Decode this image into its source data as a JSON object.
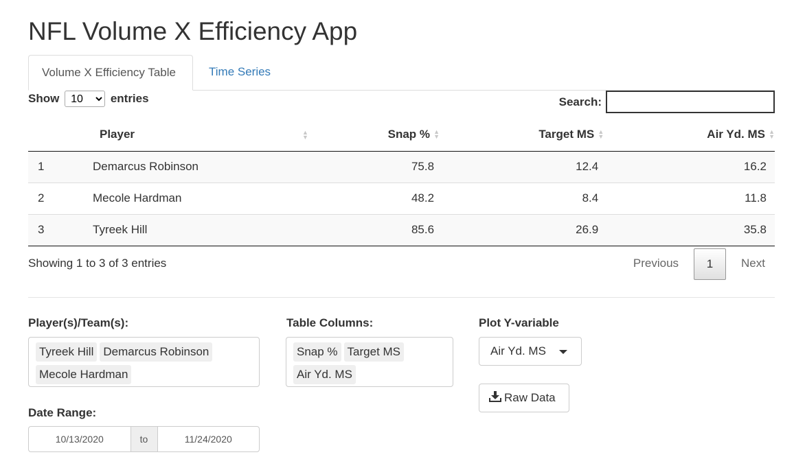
{
  "app": {
    "title": "NFL Volume X Efficiency App"
  },
  "tabs": [
    {
      "label": "Volume X Efficiency Table",
      "active": true
    },
    {
      "label": "Time Series",
      "active": false
    }
  ],
  "table_controls": {
    "show_label": "Show",
    "entries_value": "10",
    "entries_label": "entries",
    "search_label": "Search:",
    "search_value": ""
  },
  "table": {
    "columns": [
      "",
      "Player",
      "Snap %",
      "Target MS",
      "Air Yd. MS"
    ],
    "rows": [
      [
        "1",
        "Demarcus Robinson",
        "75.8",
        "12.4",
        "16.2"
      ],
      [
        "2",
        "Mecole Hardman",
        "48.2",
        "8.4",
        "11.8"
      ],
      [
        "3",
        "Tyreek Hill",
        "85.6",
        "26.9",
        "35.8"
      ]
    ],
    "info": "Showing 1 to 3 of 3 entries",
    "pager": {
      "previous": "Previous",
      "current": "1",
      "next": "Next"
    }
  },
  "controls": {
    "players_label": "Player(s)/Team(s):",
    "players": [
      "Tyreek Hill",
      "Demarcus Robinson",
      "Mecole Hardman"
    ],
    "columns_label": "Table Columns:",
    "columns": [
      "Snap %",
      "Target MS",
      "Air Yd. MS"
    ],
    "plot_y_label": "Plot Y-variable",
    "plot_y_value": "Air Yd. MS",
    "raw_data_button": "Raw Data",
    "date_range_label": "Date Range:",
    "date_start": "10/13/2020",
    "date_sep": "to",
    "date_end": "11/24/2020"
  }
}
